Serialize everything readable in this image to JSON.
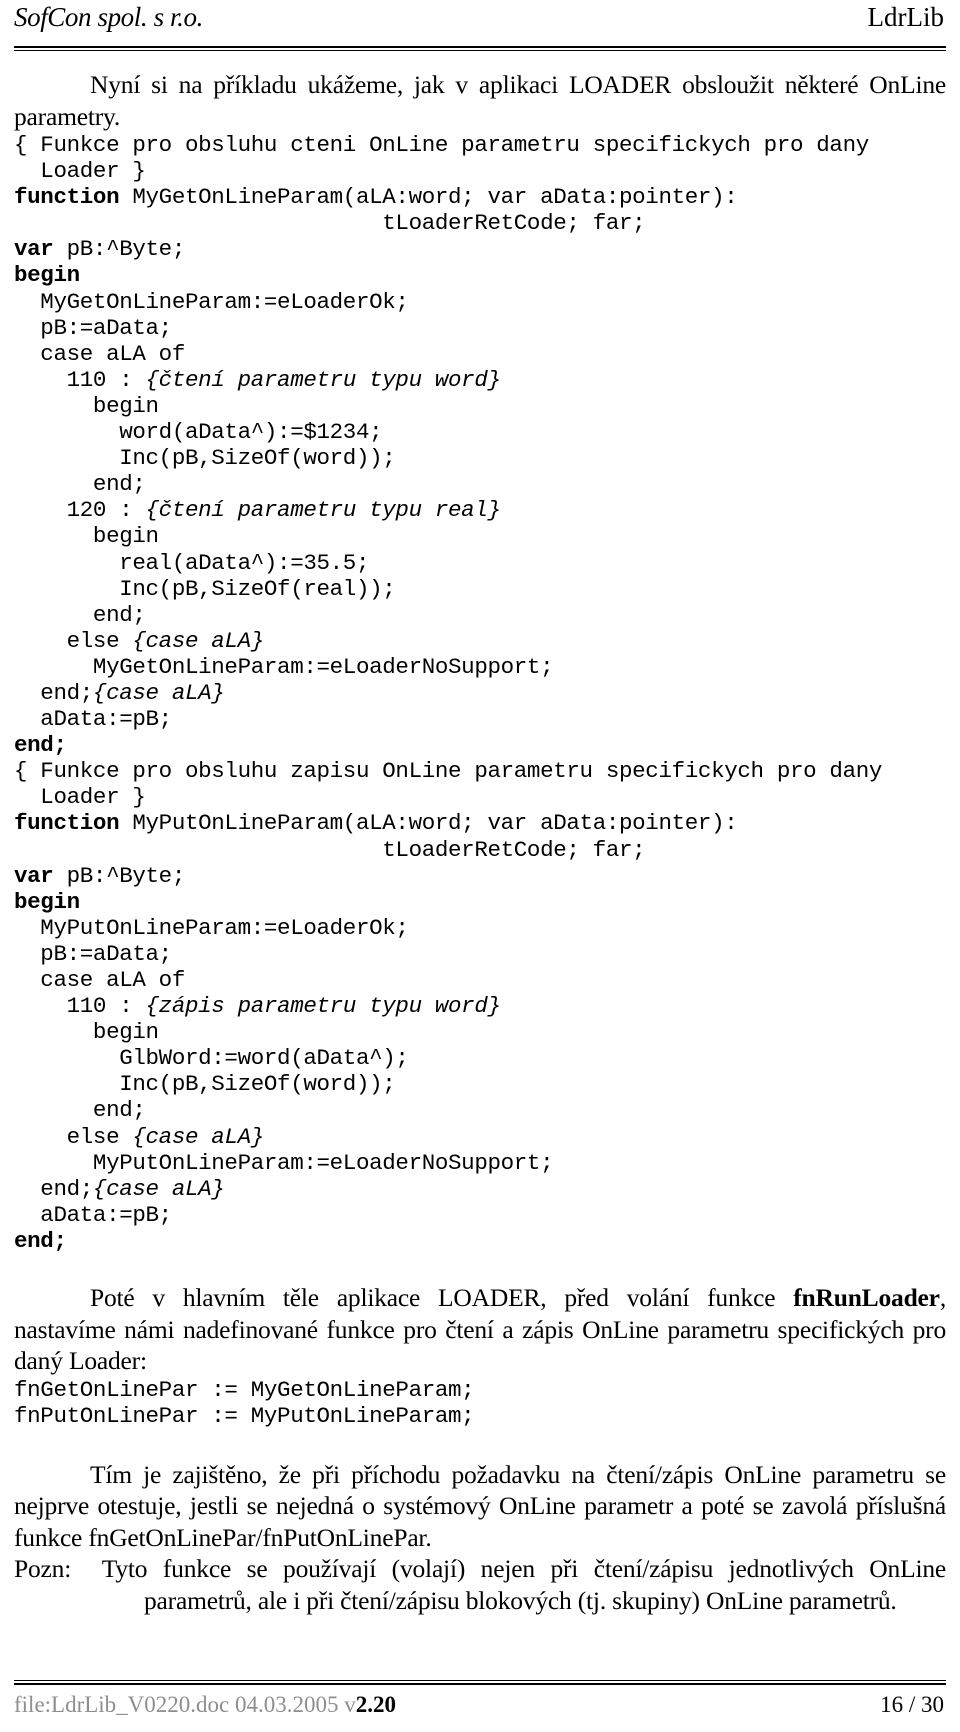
{
  "header": {
    "company": "SofCon spol. s r.o.",
    "doc_title": "LdrLib"
  },
  "intro_paragraph": {
    "text": "Nyní si na příkladu ukážeme, jak v aplikaci LOADER obsloužit některé OnLine parametry."
  },
  "code_block_read": {
    "lines": "{ Funkce pro obsluhu cteni OnLine parametru specifickych pro dany\n  Loader }\nfunction MyGetOnLineParam(aLA:word; var aData:pointer):\n                            tLoaderRetCode; far;\nvar pB:^Byte;\nbegin\n  MyGetOnLineParam:=eLoaderOk;\n  pB:=aData;\n  case aLA of\n    110 : {čtení parametru typu word}\n      begin\n        word(aData^):=$1234;\n        Inc(pB,SizeOf(word));\n      end;\n    120 : {čtení parametru typu real}\n      begin\n        real(aData^):=35.5;\n        Inc(pB,SizeOf(real));\n      end;\n    else {case aLA}\n      MyGetOnLineParam:=eLoaderNoSupport;\n  end;{case aLA}\n  aData:=pB;\nend;"
  },
  "code_block_write": {
    "lines": "{ Funkce pro obsluhu zapisu OnLine parametru specifickych pro dany\n  Loader }\nfunction MyPutOnLineParam(aLA:word; var aData:pointer):\n                            tLoaderRetCode; far;\nvar pB:^Byte;\nbegin\n  MyPutOnLineParam:=eLoaderOk;\n  pB:=aData;\n  case aLA of\n    110 : {zápis parametru typu word}\n      begin\n        GlbWord:=word(aData^);\n        Inc(pB,SizeOf(word));\n      end;\n    else {case aLA}\n      MyPutOnLineParam:=eLoaderNoSupport;\n  end;{case aLA}\n  aData:=pB;\nend;"
  },
  "paragraph_after_code": {
    "part1": "Poté v hlavním těle aplikace LOADER, před volání funkce ",
    "bold": "fnRunLoader",
    "part2": ", nastavíme námi nadefinované funkce pro čtení a zápis OnLine parametru specifických pro daný Loader:"
  },
  "code_block_assign": {
    "lines": "fnGetOnLinePar := MyGetOnLineParam;\nfnPutOnLinePar := MyPutOnLineParam;"
  },
  "paragraph_guarantee": {
    "text": "Tím je zajištěno, že při příchodu požadavku na čtení/zápis OnLine parametru se nejprve otestuje, jestli se nejedná o systémový OnLine parametr a poté se zavolá příslušná funkce fnGetOnLinePar/fnPutOnLinePar."
  },
  "paragraph_note": {
    "label": "Pozn:",
    "text": "Tyto funkce se používají (volají) nejen při čtení/zápisu jednotlivých OnLine parametrů, ale i při čtení/zápisu blokových (tj. skupiny) OnLine parametrů."
  },
  "footer": {
    "file_info": "file:LdrLib_V0220.doc  04.03.2005  v",
    "version": "2.20",
    "page_number": "16 / 30"
  }
}
